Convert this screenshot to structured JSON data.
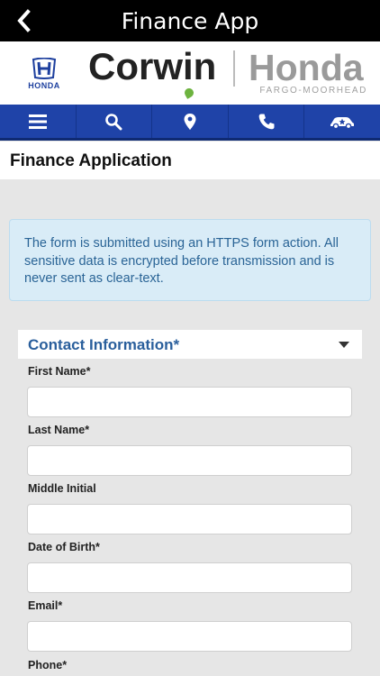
{
  "topbar": {
    "title": "Finance App",
    "back_icon": "chevron-left-icon"
  },
  "brand": {
    "honda_mark_text": "HONDA",
    "corwin": "Corwin",
    "honda": "Honda",
    "location": "FARGO-MOORHEAD",
    "colors": {
      "corwin_green": "#6db33f",
      "honda_blue": "#1d3f9e"
    }
  },
  "nav": {
    "items": [
      {
        "icon": "menu-icon"
      },
      {
        "icon": "search-icon"
      },
      {
        "icon": "location-pin-icon"
      },
      {
        "icon": "phone-icon"
      },
      {
        "icon": "car-icon"
      }
    ],
    "color": "#1f43a8"
  },
  "page": {
    "title": "Finance Application"
  },
  "notice": {
    "text": "The form is submitted using an HTTPS form action. All sensitive data is encrypted before transmission and is never sent as clear-text."
  },
  "contact": {
    "title": "Contact Information*",
    "fields": {
      "first_name": {
        "label": "First Name*",
        "value": ""
      },
      "last_name": {
        "label": "Last Name*",
        "value": ""
      },
      "middle_initial": {
        "label": "Middle Initial",
        "value": ""
      },
      "dob": {
        "label": "Date of Birth*",
        "value": ""
      },
      "email": {
        "label": "Email*",
        "value": ""
      },
      "phone": {
        "label": "Phone*",
        "value": ""
      }
    }
  }
}
